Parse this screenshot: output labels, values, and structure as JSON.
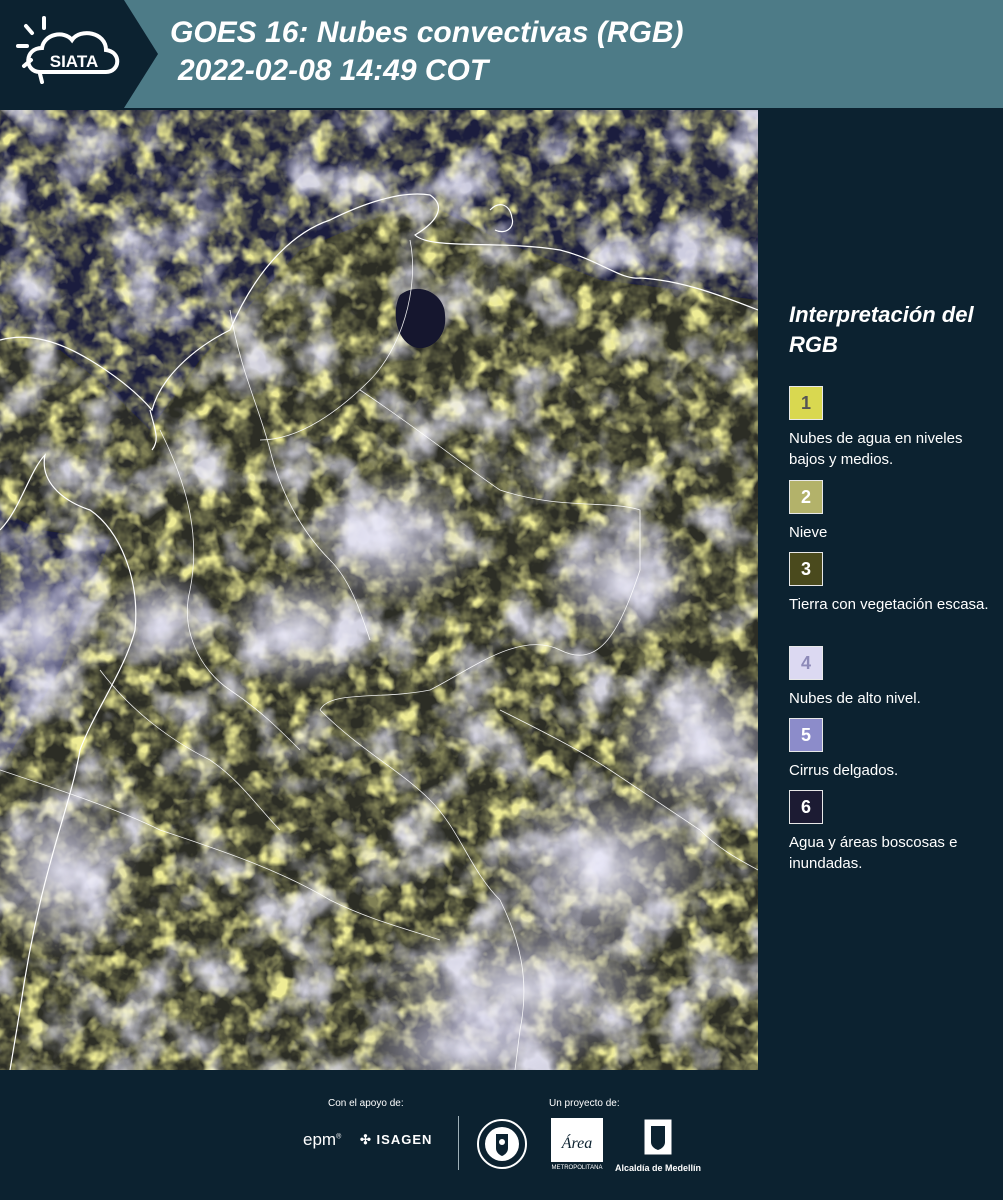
{
  "header": {
    "logo_text": "SIATA",
    "title_line1": "GOES 16: Nubes convectivas (RGB)",
    "title_line2": "2022-02-08 14:49 COT"
  },
  "legend": {
    "title": "Interpretación del RGB",
    "items": [
      {
        "number": "1",
        "label": "Nubes de agua en niveles bajos y medios.",
        "color": "#d9d850",
        "text_color": "#555555"
      },
      {
        "number": "2",
        "label": "Nieve",
        "color": "#b3b26a",
        "text_color": "#ffffff"
      },
      {
        "number": "3",
        "label": "Tierra con vegetación escasa.",
        "color": "#4a4a1d",
        "text_color": "#ffffff"
      },
      {
        "number": "4",
        "label": "Nubes de alto nivel.",
        "color": "#dcd9f2",
        "text_color": "#8d8ab8"
      },
      {
        "number": "5",
        "label": "Cirrus delgados.",
        "color": "#8c8cca",
        "text_color": "#ffffff"
      },
      {
        "number": "6",
        "label": "Agua y áreas boscosas e inundadas.",
        "color": "#1c1b33",
        "text_color": "#ffffff"
      }
    ]
  },
  "footer": {
    "support_caption": "Con el apoyo de:",
    "project_caption": "Un proyecto de:",
    "support_logos": [
      "epm",
      "ISAGEN"
    ],
    "project_logos": [
      "Área Metropolitana Valle de Aburrá",
      "Alcaldía de Medellín"
    ],
    "epm_text": "epm",
    "isagen_text": "ISAGEN",
    "area_text": "Área",
    "area_subtext": "METROPOLITANA",
    "alcaldia_text": "Alcaldía de Medellín"
  }
}
